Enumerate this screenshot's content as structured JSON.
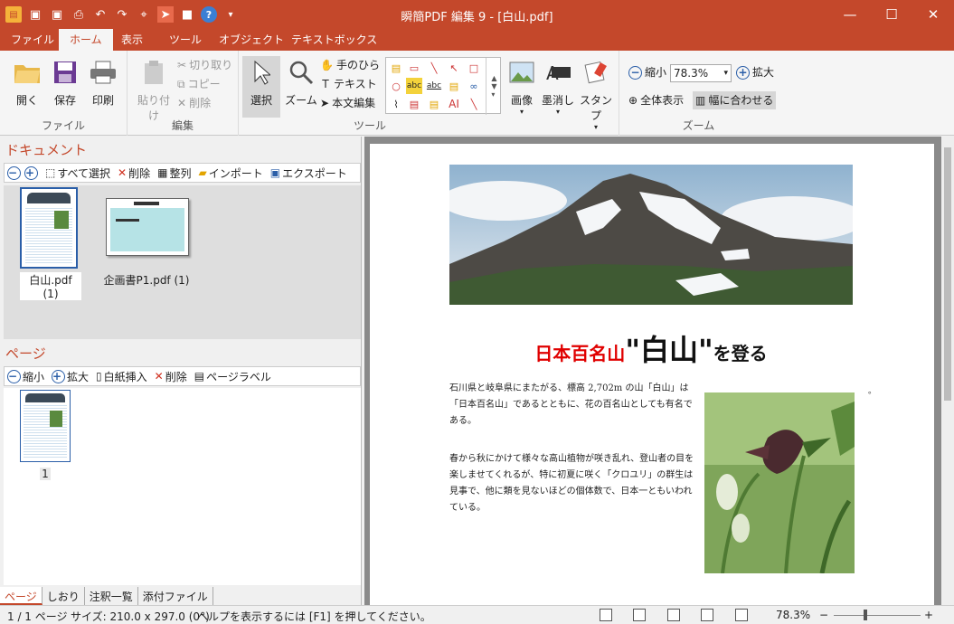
{
  "window": {
    "title": "瞬簡PDF 編集 9 - [白山.pdf]",
    "min_icon": "minimize-icon",
    "max_icon": "maximize-icon",
    "close_icon": "close-icon"
  },
  "quick_access": [
    "app-icon",
    "save-icon",
    "save-as-icon",
    "print-icon",
    "undo-icon",
    "redo-icon",
    "select-text-icon",
    "pointer-icon",
    "stop-icon",
    "help-icon",
    "customize-icon"
  ],
  "menu_tabs": [
    "ファイル",
    "ホーム",
    "表示",
    "ツール",
    "オブジェクト",
    "テキストボックス"
  ],
  "ribbon": {
    "file": {
      "open": "開く",
      "save": "保存",
      "print": "印刷",
      "group": "ファイル"
    },
    "edit": {
      "paste": "貼り付け",
      "cut": "切り取り",
      "copy": "コピー",
      "delete": "削除",
      "group": "編集"
    },
    "tools": {
      "select": "選択",
      "zoom": "ズーム",
      "hand": "手のひら",
      "text": "テキスト",
      "body_edit": "本文編集",
      "group": "ツール"
    },
    "insert": {
      "image": "画像",
      "erase": "墨消し",
      "stamp": "スタンプ"
    },
    "zoom": {
      "zoom_out": "縮小",
      "value": "78.3%",
      "zoom_in": "拡大",
      "fit_page": "全体表示",
      "fit_width": "幅に合わせる",
      "group": "ズーム"
    }
  },
  "documents": {
    "title": "ドキュメント",
    "toolbar": {
      "select_all": "すべて選択",
      "delete": "削除",
      "arrange": "整列",
      "import": "インポート",
      "export": "エクスポート"
    },
    "files": [
      {
        "name": "白山.pdf (1)"
      },
      {
        "name": "企画書P1.pdf (1)"
      }
    ]
  },
  "pages": {
    "title": "ページ",
    "toolbar": {
      "zoom_out": "縮小",
      "zoom_in": "拡大",
      "insert_blank": "白紙挿入",
      "delete": "削除",
      "page_label": "ページラベル"
    },
    "items": [
      "1"
    ]
  },
  "bottom_tabs": [
    "ページ",
    "しおり",
    "注釈一覧",
    "添付ファイル"
  ],
  "pdf": {
    "title_red": "日本百名山",
    "title_big": "\"白山\"",
    "title_small": "を登る",
    "para1": "石川県と岐阜県にまたがる、標高 2,702m の山「白山」は「日本百名山」であるとともに、花の百名山としても有名である。",
    "para2": "春から秋にかけて様々な高山植物が咲き乱れ、登山者の目を楽しませてくれるが、特に初夏に咲く「クロユリ」の群生は見事で、他に類を見ないほどの個体数で、日本一ともいわれている。",
    "dot": "。"
  },
  "status": {
    "page": "1 / 1 ページ",
    "size": "サイズ: 210.0 x 297.0 (0°)",
    "help": "ヘルプを表示するには [F1] を押してください。",
    "zoom": "78.3%"
  },
  "colors": {
    "accent": "#c4482b",
    "pdf_red": "#e00000"
  }
}
